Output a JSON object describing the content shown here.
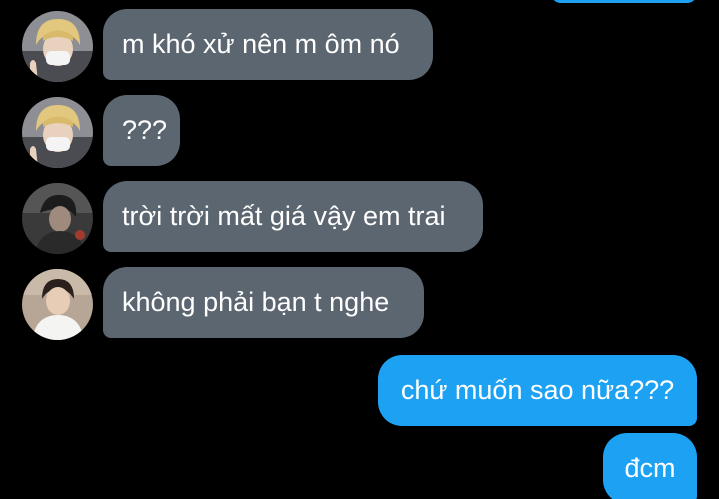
{
  "messages": [
    {
      "side": "incoming",
      "avatar": "avatar-blond-masked",
      "text": "m khó xử nên m ôm nó"
    },
    {
      "side": "incoming",
      "avatar": "avatar-blond-masked",
      "text": "???"
    },
    {
      "side": "incoming",
      "avatar": "avatar-dark-photo",
      "text": "trời trời mất giá vậy em trai"
    },
    {
      "side": "incoming",
      "avatar": "avatar-white-shirt",
      "text": "không phải bạn t nghe"
    },
    {
      "side": "outgoing",
      "text": "chứ muốn sao nữa???"
    },
    {
      "side": "outgoing",
      "text": "đcm"
    }
  ],
  "colors": {
    "background": "#000000",
    "incoming_bubble": "#5b6670",
    "outgoing_bubble": "#1da1f2",
    "text": "#ffffff"
  }
}
